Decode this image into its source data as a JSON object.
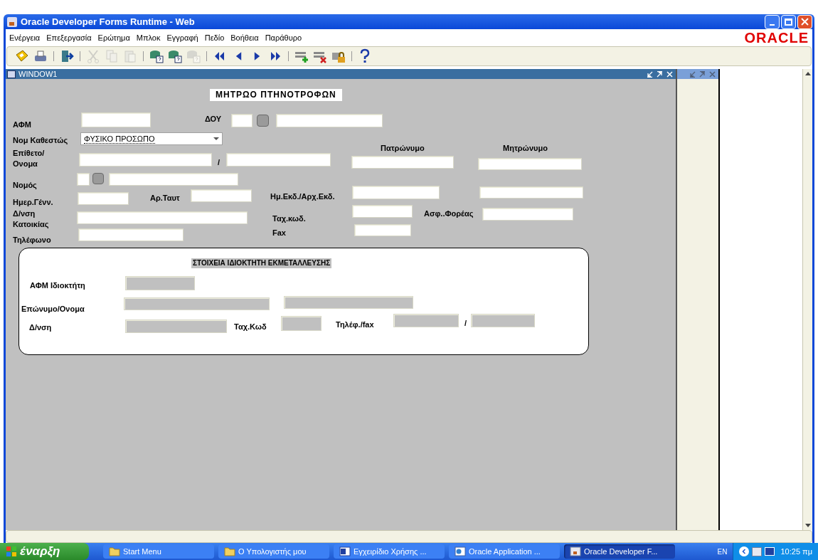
{
  "window": {
    "title": "Oracle Developer Forms Runtime - Web"
  },
  "menu": [
    "Ενέργεια",
    "Επεξεργασία",
    "Ερώτημα",
    "Μπλοκ",
    "Εγγραφή",
    "Πεδίο",
    "Βοήθεια",
    "Παράθυρο"
  ],
  "logo": "ORACLE",
  "toolbar": [
    [
      {
        "kind": "save",
        "disabled": false
      },
      {
        "kind": "print",
        "disabled": false
      }
    ],
    [
      {
        "kind": "exit",
        "disabled": false
      }
    ],
    [
      {
        "kind": "cut",
        "disabled": true
      },
      {
        "kind": "copy",
        "disabled": true
      },
      {
        "kind": "paste",
        "disabled": true
      }
    ],
    [
      {
        "kind": "query-enter",
        "disabled": false
      },
      {
        "kind": "query-execute",
        "disabled": false
      },
      {
        "kind": "query-cancel",
        "disabled": true
      }
    ],
    [
      {
        "kind": "first",
        "disabled": false
      },
      {
        "kind": "prev",
        "disabled": false
      },
      {
        "kind": "next",
        "disabled": false
      },
      {
        "kind": "last",
        "disabled": false
      }
    ],
    [
      {
        "kind": "insert",
        "disabled": false
      },
      {
        "kind": "delete",
        "disabled": false
      },
      {
        "kind": "lock",
        "disabled": false
      }
    ],
    [
      {
        "kind": "help",
        "disabled": false
      }
    ]
  ],
  "inner_window": {
    "title": "WINDOW1"
  },
  "form": {
    "title": "ΜΗΤΡΩΟ ΠΤΗΝΟΤΡΟΦΩΝ",
    "items": [
      {
        "kind": "label",
        "text": "ΑΦΜ"
      },
      {
        "kind": "field"
      },
      {
        "kind": "label",
        "text": "ΔΟΥ"
      },
      {
        "kind": "field"
      },
      {
        "kind": "lov"
      },
      {
        "kind": "field"
      },
      {
        "kind": "label",
        "text": "Νομ Καθεστώς"
      },
      {
        "kind": "dropdown",
        "value": "ΦΥΣΙΚΟ ΠΡΟΣΩΠΟ"
      },
      {
        "kind": "label",
        "text": "Επίθετο/ Ονομα"
      },
      {
        "kind": "field"
      },
      {
        "kind": "label",
        "text": "/"
      },
      {
        "kind": "field"
      },
      {
        "kind": "label",
        "text": "Πατρώνυμο"
      },
      {
        "kind": "field"
      },
      {
        "kind": "label",
        "text": "Μητρώνυμο"
      },
      {
        "kind": "field"
      },
      {
        "kind": "label",
        "text": "Νομός"
      },
      {
        "kind": "field"
      },
      {
        "kind": "lov"
      },
      {
        "kind": "field"
      },
      {
        "kind": "label",
        "text": "Ημερ.Γένν."
      },
      {
        "kind": "field"
      },
      {
        "kind": "label",
        "text": "Αρ.Ταυτ"
      },
      {
        "kind": "field"
      },
      {
        "kind": "label",
        "text": "Ημ.Εκδ./Αρχ.Εκδ."
      },
      {
        "kind": "field"
      },
      {
        "kind": "field"
      },
      {
        "kind": "label",
        "text": "Δ/νση Κατοικίας"
      },
      {
        "kind": "field"
      },
      {
        "kind": "label",
        "text": "Ταχ.κωδ."
      },
      {
        "kind": "field"
      },
      {
        "kind": "label",
        "text": "Ασφ..Φορέας"
      },
      {
        "kind": "field"
      },
      {
        "kind": "label",
        "text": "Τηλέφωνο"
      },
      {
        "kind": "field"
      },
      {
        "kind": "label",
        "text": "Fax"
      },
      {
        "kind": "field"
      }
    ]
  },
  "owner_panel": {
    "title": "ΣΤΟΙΧΕΙΑ ΙΔΙΟΚΤΗΤΗ ΕΚΜΕΤΑΛΛΕΥΣΗΣ",
    "items": [
      {
        "kind": "label",
        "text": "ΑΦΜ Ιδιοκτήτη"
      },
      {
        "kind": "field"
      },
      {
        "kind": "label",
        "text": "Επώνυμο/Ονομα"
      },
      {
        "kind": "field"
      },
      {
        "kind": "field"
      },
      {
        "kind": "label",
        "text": "Δ/νση"
      },
      {
        "kind": "field"
      },
      {
        "kind": "label",
        "text": "Ταχ.Κωδ"
      },
      {
        "kind": "field"
      },
      {
        "kind": "label",
        "text": "Τηλέφ./fax"
      },
      {
        "kind": "field"
      },
      {
        "kind": "label",
        "text": "/"
      },
      {
        "kind": "field"
      }
    ]
  },
  "taskbar": {
    "start": "έναρξη",
    "tasks": [
      {
        "label": "Start Menu",
        "kind": "folder",
        "selected": false
      },
      {
        "label": "Ο Υπολογιστής μου",
        "kind": "folder",
        "selected": false
      },
      {
        "label": "Εγχειρίδιο Χρήσης ...",
        "kind": "word",
        "selected": false
      },
      {
        "label": "Oracle Application ...",
        "kind": "browser",
        "selected": false
      },
      {
        "label": "Oracle Developer F...",
        "kind": "java",
        "selected": true
      }
    ],
    "language": "EN",
    "clock": "10:25 πμ"
  }
}
